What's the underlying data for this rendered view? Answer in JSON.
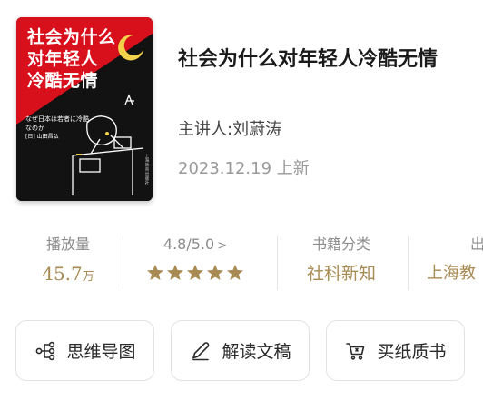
{
  "book": {
    "cover": {
      "title_lines": [
        "社会为什么",
        "对年轻人",
        "冷酷无情"
      ],
      "subtitle_jp": "なぜ日本は若者に冷酷なのか",
      "author": "[日] 山田昌弘",
      "publisher": "上海教育出版社"
    },
    "title": "社会为什么对年轻人冷酷无情",
    "speaker": "主讲人:刘蔚涛",
    "date": "2023.12.19 上新"
  },
  "stats": {
    "views_label": "播放量",
    "views_value": "45.7",
    "views_unit": "万",
    "rating_label": "4.8/5.0",
    "rating_chevron": ">",
    "rating_stars": 5,
    "category_label": "书籍分类",
    "category_value": "社科新知",
    "publisher_label": "出",
    "publisher_value": "上海教"
  },
  "actions": {
    "mind_map": "思维导图",
    "transcript": "解读文稿",
    "buy_book": "买纸质书"
  },
  "colors": {
    "gold": "#a88a53",
    "cover_red": "#d8101c",
    "cover_dark": "#121212"
  }
}
